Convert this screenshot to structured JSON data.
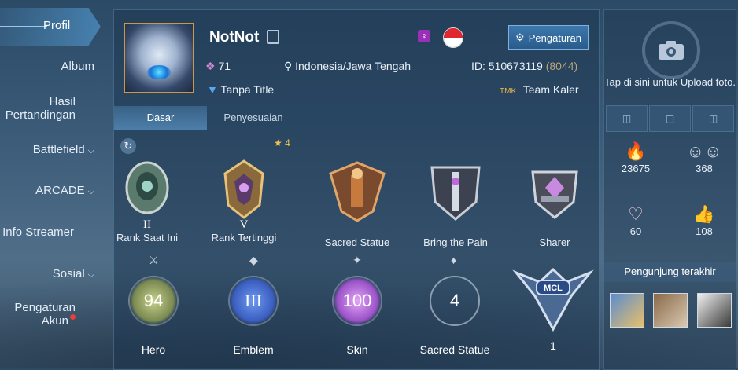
{
  "nav": {
    "active": "Profil",
    "items": [
      {
        "label": "Album",
        "chevron": false
      },
      {
        "label": "Hasil Pertandingan",
        "chevron": false
      },
      {
        "label": "Battlefield",
        "chevron": true
      },
      {
        "label": "ARCADE",
        "chevron": true
      },
      {
        "label": "Info Streamer",
        "chevron": false
      },
      {
        "label": "Sosial",
        "chevron": true
      },
      {
        "label": "Pengaturan Akun",
        "chevron": false,
        "notification_dot": true
      }
    ]
  },
  "profile": {
    "name": "NotNot",
    "level": "71",
    "location": "Indonesia/Jawa Tengah",
    "id_label": "ID: 510673119",
    "server": "(8044)",
    "title": "Tanpa Title",
    "team_tag": "TMK",
    "team": "Team Kaler",
    "gender_symbol": "♀",
    "settings_button": "Pengaturan"
  },
  "tabs": [
    "Dasar",
    "Penyesuaian"
  ],
  "achievements": {
    "highest_rank_stars": "4",
    "badges": [
      {
        "label": "Rank Saat Ini",
        "numeral": "II"
      },
      {
        "label": "Rank Tertinggi",
        "numeral": "V"
      },
      {
        "label": "Sacred Statue",
        "numeral": ""
      },
      {
        "label": "Bring the Pain",
        "numeral": ""
      },
      {
        "label": "Sharer",
        "numeral": ""
      }
    ]
  },
  "stats": [
    {
      "label": "Hero",
      "value": "94"
    },
    {
      "label": "Emblem",
      "value": "III"
    },
    {
      "label": "Skin",
      "value": "100"
    },
    {
      "label": "Sacred Statue",
      "value": "4"
    },
    {
      "label": "1",
      "value": "MCL"
    }
  ],
  "right_panel": {
    "upload_text": "Tap di sini untuk Upload foto.",
    "stats": {
      "popularity": "23675",
      "followers": "368",
      "charm": "60",
      "likes": "108"
    },
    "visitors_label": "Pengunjung terakhir"
  },
  "colors": {
    "accent": "#5aaae6",
    "button": "#2f6a9e",
    "gold": "#c79a4a",
    "hero_ring": "#9aa86a",
    "emblem_ring": "#4d7fe0",
    "skin_ring": "#b56fd8"
  }
}
